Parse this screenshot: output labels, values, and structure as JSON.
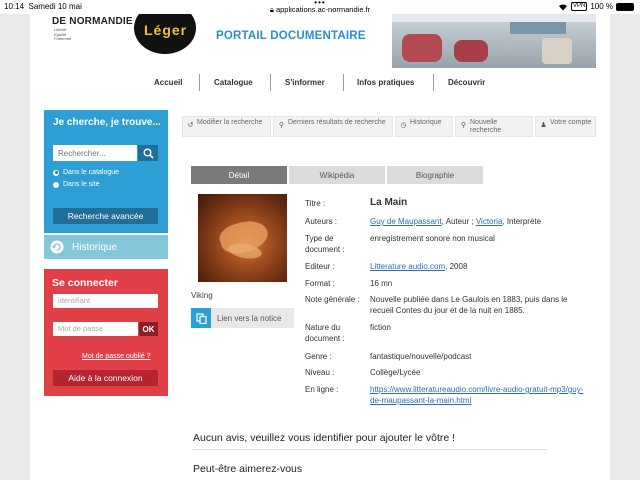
{
  "status_bar": {
    "time": "10:14",
    "date": "Samedi 10 mai",
    "url": "applications.ac-normandie.fr",
    "dots": "•••",
    "vpn": "VPN",
    "battery": "100 %"
  },
  "header": {
    "region": "DE NORMANDIE",
    "motto": [
      "Liberté",
      "Égalité",
      "Fraternité"
    ],
    "logo_text": "Léger",
    "portal_title": "PORTAIL DOCUMENTAIRE"
  },
  "nav": {
    "items": [
      "Accueil",
      "Catalogue",
      "S'informer",
      "Infos pratiques",
      "Découvrir"
    ]
  },
  "search_panel": {
    "title": "Je cherche, je trouve...",
    "placeholder": "Rechercher...",
    "options": [
      "Dans le catalogue",
      "Dans le site"
    ],
    "advanced": "Recherche avancée"
  },
  "history_panel": {
    "label": "Historique"
  },
  "login_panel": {
    "title": "Se connecter",
    "id_placeholder": "identifiant",
    "pw_placeholder": "Mot de passe",
    "ok": "OK",
    "forgot": "Mot de passe oublié ?",
    "help": "Aide à la connexion"
  },
  "toolbar": {
    "modify": "Modifier la recherche",
    "last_results": "Derniers résultats de recherche",
    "history": "Historique",
    "new_search": "Nouvelle recherche",
    "account": "Votre compte"
  },
  "tabs": [
    "Détail",
    "Wikipédia",
    "Biographie"
  ],
  "cover": {
    "caption": "Viking",
    "notice_link": "Lien vers la notice"
  },
  "record": {
    "labels": {
      "title": "Titre :",
      "authors": "Auteurs :",
      "doc_type": "Type de document :",
      "publisher": "Editeur :",
      "format": "Format :",
      "general_note": "Note générale :",
      "nature": "Nature du document :",
      "genre": "Genre :",
      "level": "Niveau :",
      "online": "En ligne :"
    },
    "title": "La Main",
    "author1": "Guy de Maupassant",
    "author1_role": ", Auteur ; ",
    "author2": "Victoria",
    "author2_role": ", Interprète",
    "doc_type": "enregistrement sonore non musical",
    "publisher": "Litterature audio.com",
    "publisher_year": ", 2008",
    "format": "16 mn",
    "general_note": "Nouvelle publiée dans Le Gaulois en 1883, puis dans le recueil Contes du jour et de la nuit en 1885.",
    "nature": "fiction",
    "genre": "fantastique/nouvelle/podcast",
    "level": "Collège/Lycée",
    "online": "https://www.litteratureaudio.com/livre-audio-gratuit-mp3/guy-de-maupassant-la-main.html"
  },
  "reviews": {
    "prompt": "Aucun avis, veuillez vous identifier pour ajouter le vôtre !",
    "you_may_like": "Peut-être aimerez-vous"
  }
}
